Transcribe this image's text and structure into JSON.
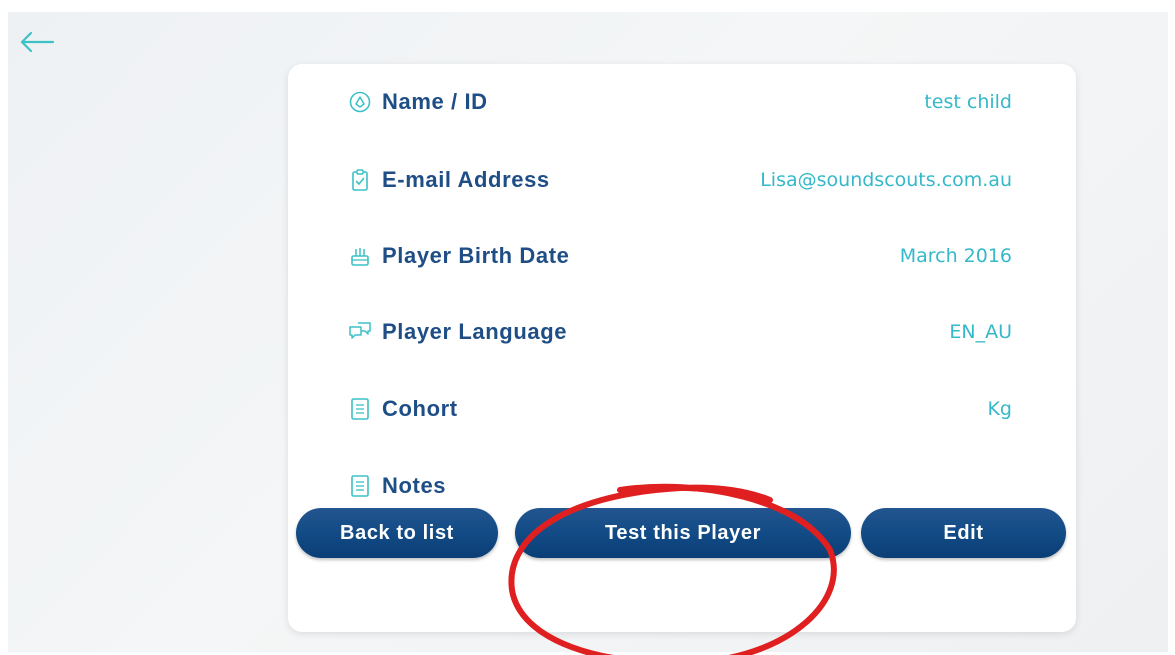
{
  "header": {
    "back_icon": "arrow-left-icon"
  },
  "profile": {
    "rows": [
      {
        "label": "Name / ID",
        "value": "test child",
        "icon": "rocket-badge-icon"
      },
      {
        "label": "E-mail Address",
        "value": "Lisa@soundscouts.com.au",
        "icon": "clipboard-check-icon"
      },
      {
        "label": "Player Birth Date",
        "value": "March 2016",
        "icon": "cake-icon"
      },
      {
        "label": "Player Language",
        "value": "EN_AU",
        "icon": "speech-bubbles-icon"
      },
      {
        "label": "Cohort",
        "value": "Kg",
        "icon": "document-icon"
      },
      {
        "label": "Notes",
        "value": "",
        "icon": "document-icon"
      }
    ]
  },
  "buttons": {
    "back_to_list": "Back to list",
    "test_player": "Test this Player",
    "edit": "Edit"
  },
  "colors": {
    "label": "#1f4e86",
    "value": "#35b8c9",
    "button": "#124b86",
    "annotation": "#e02020"
  }
}
